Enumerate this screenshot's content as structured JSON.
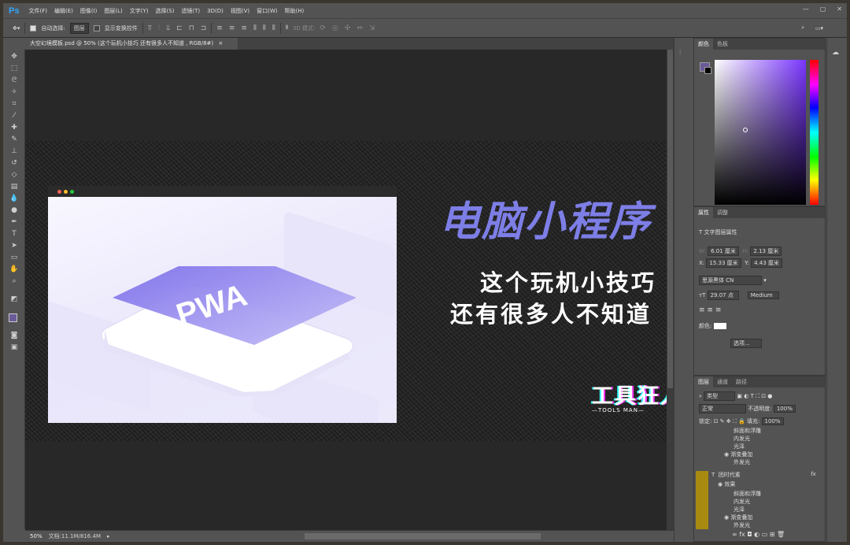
{
  "app": {
    "logo": "Ps"
  },
  "menu": [
    "文件(F)",
    "编辑(E)",
    "图像(I)",
    "图层(L)",
    "文字(Y)",
    "选择(S)",
    "滤镜(T)",
    "3D(D)",
    "视图(V)",
    "窗口(W)",
    "帮助(H)"
  ],
  "window_controls": [
    "—",
    "▢",
    "✕"
  ],
  "options": {
    "auto_select_label": "自动选择:",
    "auto_select_value": "图层",
    "show_transform_label": "显示变换控件",
    "mode_3d": "3D 模式:"
  },
  "document": {
    "tab_title": "大空幻境模板.psd @ 50% (这个玩机小技巧 还有很多人不知道 , RGB/8#)",
    "tab_close": "×",
    "headline": "电脑小程序",
    "subtitle_line1": "这个玩机小技巧",
    "subtitle_line2": "还有很多人不知道",
    "logo_text": "工具狂人",
    "logo_subtext": "—TOOLS MAN—",
    "mockup_badge": "PWA"
  },
  "status": {
    "zoom": "50%",
    "doc_info": "文档:11.1M/816.4M"
  },
  "color_panel": {
    "tabs": [
      "颜色",
      "色板"
    ],
    "fg_color": "#6a5a9a",
    "bg_color": "#000000"
  },
  "properties_panel": {
    "tabs": [
      "属性",
      "调整"
    ],
    "section": "文字图层属性",
    "w_label": "W:",
    "w_value": "6.01 厘米",
    "h_label": "H:",
    "h_value": "2.13 厘米",
    "x_label": "X:",
    "x_value": "15.33 厘米",
    "y_label": "Y:",
    "y_value": "4.43 厘米",
    "font_family": "思源黑体 CN",
    "font_size": "29.07 点",
    "font_weight": "Medium",
    "color_label": "颜色:",
    "more_button": "选项..."
  },
  "layers_panel": {
    "tabs": [
      "图层",
      "通道",
      "路径"
    ],
    "filter_label": "类型",
    "blend_mode": "正常",
    "opacity_label": "不透明度:",
    "opacity_value": "100%",
    "lock_label": "锁定:",
    "fill_label": "填充:",
    "fill_value": "100%",
    "rows": [
      "斜面和浮雕",
      "内发光",
      "光泽",
      "渐变叠加",
      "外发光"
    ],
    "layer_name": "团时代素",
    "effects_label": "效果",
    "rows2": [
      "斜面和浮雕",
      "内发光",
      "光泽",
      "渐变叠加",
      "外发光"
    ],
    "fx": "fx"
  },
  "colors": {
    "accent": "#7d7ee6",
    "ui_bg": "#535353",
    "canvas_bg": "#282828"
  }
}
